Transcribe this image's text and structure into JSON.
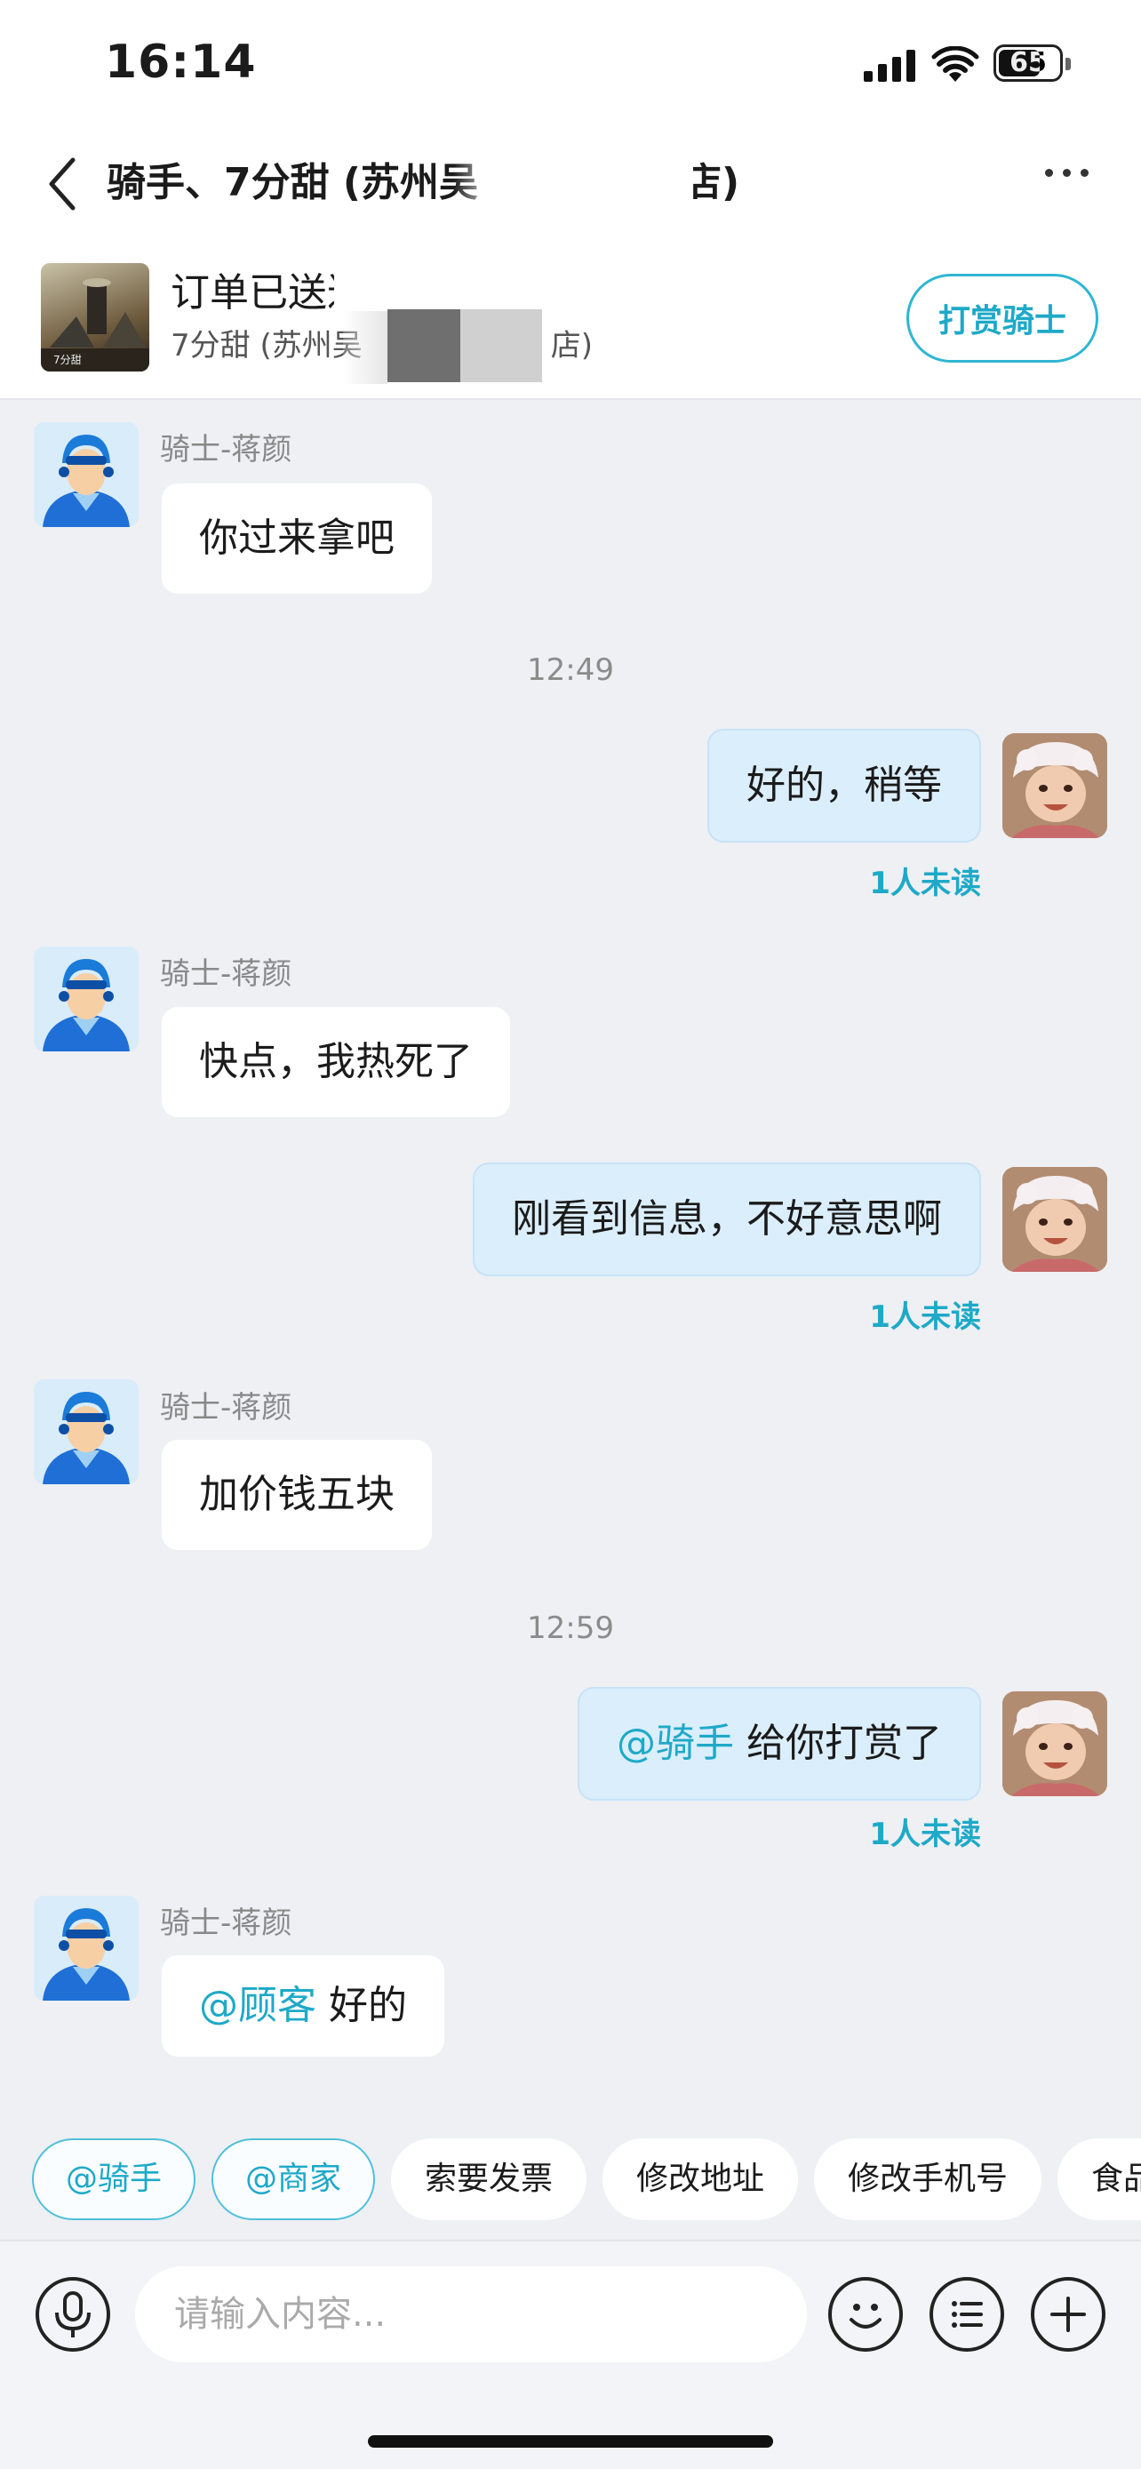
{
  "status": {
    "time": "16:14",
    "battery": "65"
  },
  "header": {
    "title_left": "骑手、7分甜 (苏州吴",
    "title_right": "店)"
  },
  "order": {
    "status": "订单已送达",
    "shop": "7分甜 (苏州吴",
    "shop_tail": "店)",
    "tip_button": "打赏骑士"
  },
  "messages": [
    {
      "from": "rider",
      "sender": "骑士-蒋颜",
      "text": "你过来拿吧"
    },
    {
      "timestamp": "12:49"
    },
    {
      "from": "me",
      "text": "好的，稍等",
      "status": "1人未读"
    },
    {
      "from": "rider",
      "sender": "骑士-蒋颜",
      "text": "快点，我热死了"
    },
    {
      "from": "me",
      "text": "刚看到信息，不好意思啊",
      "status": "1人未读"
    },
    {
      "from": "rider",
      "sender": "骑士-蒋颜",
      "text": "加价钱五块"
    },
    {
      "timestamp": "12:59"
    },
    {
      "from": "me",
      "mention": "@骑手",
      "text": " 给你打赏了",
      "status": "1人未读"
    },
    {
      "from": "rider",
      "sender": "骑士-蒋颜",
      "mention": "@顾客",
      "text": " 好的"
    }
  ],
  "quick_chips": [
    "@骑手",
    "@商家",
    "索要发票",
    "修改地址",
    "修改手机号",
    "食品"
  ],
  "input": {
    "placeholder": "请输入内容..."
  },
  "colors": {
    "accent": "#1ea9c8",
    "bubble_out": "#dbeefb",
    "background": "#eef0f4"
  }
}
